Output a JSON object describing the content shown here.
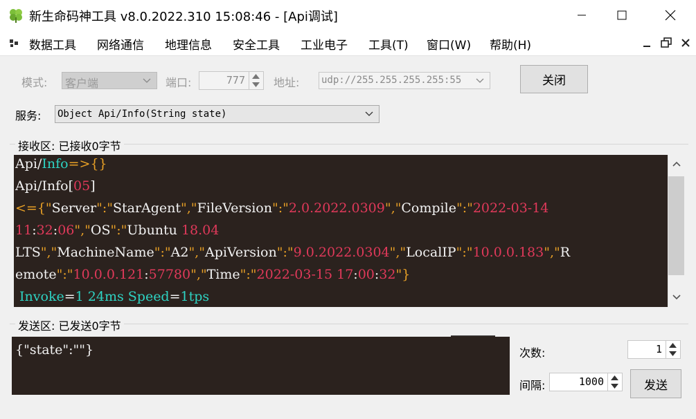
{
  "window": {
    "title": "新生命码神工具 v8.0.2022.310 15:08:46 - [Api调试]"
  },
  "menu": {
    "items": [
      "数据工具",
      "网络通信",
      "地理信息",
      "安全工具",
      "工业电子",
      "工具(T)",
      "窗口(W)",
      "帮助(H)"
    ]
  },
  "connection": {
    "mode_label": "模式:",
    "mode_value": "客户端",
    "port_label": "端口:",
    "port_value": "777",
    "address_label": "地址:",
    "address_value": "udp://255.255.255.255:55",
    "close_button": "关闭"
  },
  "service": {
    "label": "服务:",
    "value": "Object Api/Info(String state)"
  },
  "receive": {
    "label": "接收区: 已接收0字节",
    "lines": [
      [
        {
          "t": "Api/",
          "c": "w"
        },
        {
          "t": "Info",
          "c": "c"
        },
        {
          "t": "=>",
          "c": "o"
        },
        {
          "t": "{}",
          "c": "o"
        }
      ],
      [
        {
          "t": "Api/Info[",
          "c": "w"
        },
        {
          "t": "05",
          "c": "r"
        },
        {
          "t": "]",
          "c": "w"
        }
      ],
      [
        {
          "t": "<=",
          "c": "o"
        },
        {
          "t": "{\"",
          "c": "o"
        },
        {
          "t": "Server",
          "c": "w"
        },
        {
          "t": "\":\"",
          "c": "o"
        },
        {
          "t": "StarAgent",
          "c": "w"
        },
        {
          "t": "\",\"",
          "c": "o"
        },
        {
          "t": "FileVersion",
          "c": "w"
        },
        {
          "t": "\":\"",
          "c": "o"
        },
        {
          "t": "2.0.2022.0309",
          "c": "r"
        },
        {
          "t": "\",\"",
          "c": "o"
        },
        {
          "t": "Compile",
          "c": "w"
        },
        {
          "t": "\":\"",
          "c": "o"
        },
        {
          "t": "2022-03-14",
          "c": "r"
        }
      ],
      [
        {
          "t": "11",
          "c": "r"
        },
        {
          "t": ":",
          "c": "w"
        },
        {
          "t": "32",
          "c": "r"
        },
        {
          "t": ":",
          "c": "w"
        },
        {
          "t": "06",
          "c": "r"
        },
        {
          "t": "\",\"",
          "c": "o"
        },
        {
          "t": "OS",
          "c": "w"
        },
        {
          "t": "\":\"",
          "c": "o"
        },
        {
          "t": "Ubuntu ",
          "c": "w"
        },
        {
          "t": "18.04",
          "c": "r"
        }
      ],
      [
        {
          "t": "LTS",
          "c": "w"
        },
        {
          "t": "\",\"",
          "c": "o"
        },
        {
          "t": "MachineName",
          "c": "w"
        },
        {
          "t": "\":\"",
          "c": "o"
        },
        {
          "t": "A2",
          "c": "w"
        },
        {
          "t": "\",\"",
          "c": "o"
        },
        {
          "t": "ApiVersion",
          "c": "w"
        },
        {
          "t": "\":\"",
          "c": "o"
        },
        {
          "t": "9.0.2022.0304",
          "c": "r"
        },
        {
          "t": "\",\"",
          "c": "o"
        },
        {
          "t": "LocalIP",
          "c": "w"
        },
        {
          "t": "\":\"",
          "c": "o"
        },
        {
          "t": "10.0.0.183",
          "c": "r"
        },
        {
          "t": "\",\"",
          "c": "o"
        },
        {
          "t": "R",
          "c": "w"
        }
      ],
      [
        {
          "t": "emote",
          "c": "w"
        },
        {
          "t": "\":\"",
          "c": "o"
        },
        {
          "t": "10.0.0.121",
          "c": "r"
        },
        {
          "t": ":",
          "c": "w"
        },
        {
          "t": "57780",
          "c": "r"
        },
        {
          "t": "\",\"",
          "c": "o"
        },
        {
          "t": "Time",
          "c": "w"
        },
        {
          "t": "\":\"",
          "c": "o"
        },
        {
          "t": "2022-03-15 17",
          "c": "r"
        },
        {
          "t": ":",
          "c": "w"
        },
        {
          "t": "00",
          "c": "r"
        },
        {
          "t": ":",
          "c": "w"
        },
        {
          "t": "32",
          "c": "r"
        },
        {
          "t": "\"}",
          "c": "o"
        }
      ],
      [
        {
          "t": " Invoke",
          "c": "c"
        },
        {
          "t": "=",
          "c": "w"
        },
        {
          "t": "1",
          "c": "c"
        },
        {
          "t": " 24ms ",
          "c": "c"
        },
        {
          "t": "Speed",
          "c": "c"
        },
        {
          "t": "=",
          "c": "w"
        },
        {
          "t": "1tps",
          "c": "c"
        }
      ]
    ]
  },
  "send": {
    "label": "发送区: 已发送0字节",
    "content": "{\"state\":\"\"}",
    "count_label": "次数:",
    "count_value": "1",
    "interval_label": "间隔:",
    "interval_value": "1000",
    "send_button": "发送"
  },
  "colors": {
    "panel_bg": "#2b221e",
    "white": "#f2f2f2",
    "cyan": "#2ed3c3",
    "orange": "#e8a026",
    "red": "#e0395a"
  },
  "icons": [
    "clover-icon",
    "minimize-icon",
    "maximize-icon",
    "close-icon",
    "mdi-menu-icon",
    "mdi-minimize-icon",
    "mdi-restore-icon",
    "mdi-close-icon",
    "chevron-down-icon",
    "spin-up-icon",
    "spin-down-icon",
    "scroll-up-icon",
    "scroll-down-icon"
  ]
}
